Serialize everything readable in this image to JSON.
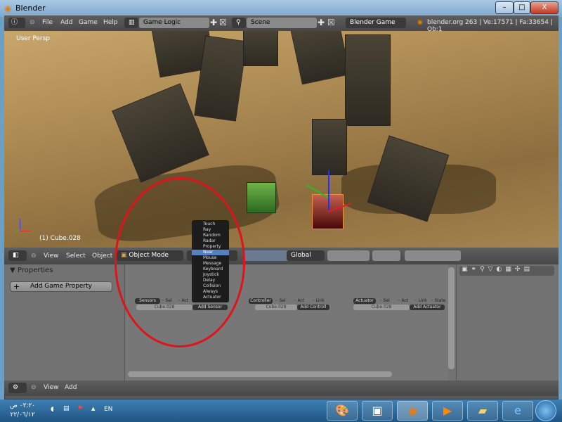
{
  "window": {
    "title": "Blender",
    "minimize": "–",
    "maximize": "□",
    "close": "X"
  },
  "topbar": {
    "menus": [
      "File",
      "Add",
      "Game",
      "Help"
    ],
    "screen_layout": "Game Logic",
    "scene": "Scene",
    "engine": "Blender Game",
    "stats": "blender.org 263 | Ve:17571 | Fa:33654 | Ob:1"
  },
  "viewport": {
    "view_label": "User Persp",
    "object_label": "(1) Cube.028"
  },
  "view3d_header": {
    "menus": [
      "View",
      "Select",
      "Object"
    ],
    "mode": "Object Mode",
    "orientation": "Global"
  },
  "properties_panel": {
    "title": "Properties",
    "add_button": "Add Game Property"
  },
  "logic": {
    "sensors": {
      "label": "Sensors",
      "sel": "Sel",
      "act": "Act",
      "object": "Cube.028",
      "add": "Add Sensor"
    },
    "controllers": {
      "label": "Controller",
      "sel": "Sel",
      "act": "Act",
      "link": "Link",
      "object": "Cube.028",
      "add": "Add Controll"
    },
    "actuators": {
      "label": "Actuator",
      "sel": "Sel",
      "act": "Act",
      "link": "Link",
      "state": "State",
      "object": "Cube.028",
      "add": "Add Actuator"
    }
  },
  "sensor_menu": {
    "items": [
      "Touch",
      "Ray",
      "Random",
      "Radar",
      "Property",
      "Near",
      "Mouse",
      "Message",
      "Keyboard",
      "Joystick",
      "Delay",
      "Collision",
      "Always",
      "Actuator"
    ],
    "selected": "Near"
  },
  "bottom_header": {
    "menus": [
      "View",
      "Add"
    ]
  },
  "taskbar": {
    "time": "٠٢:٢٠ ص",
    "date": "٢٢/٠٦/١٢",
    "language": "EN"
  },
  "colors": {
    "annotation": "#e0131b",
    "menu_highlight": "#5680c2"
  }
}
